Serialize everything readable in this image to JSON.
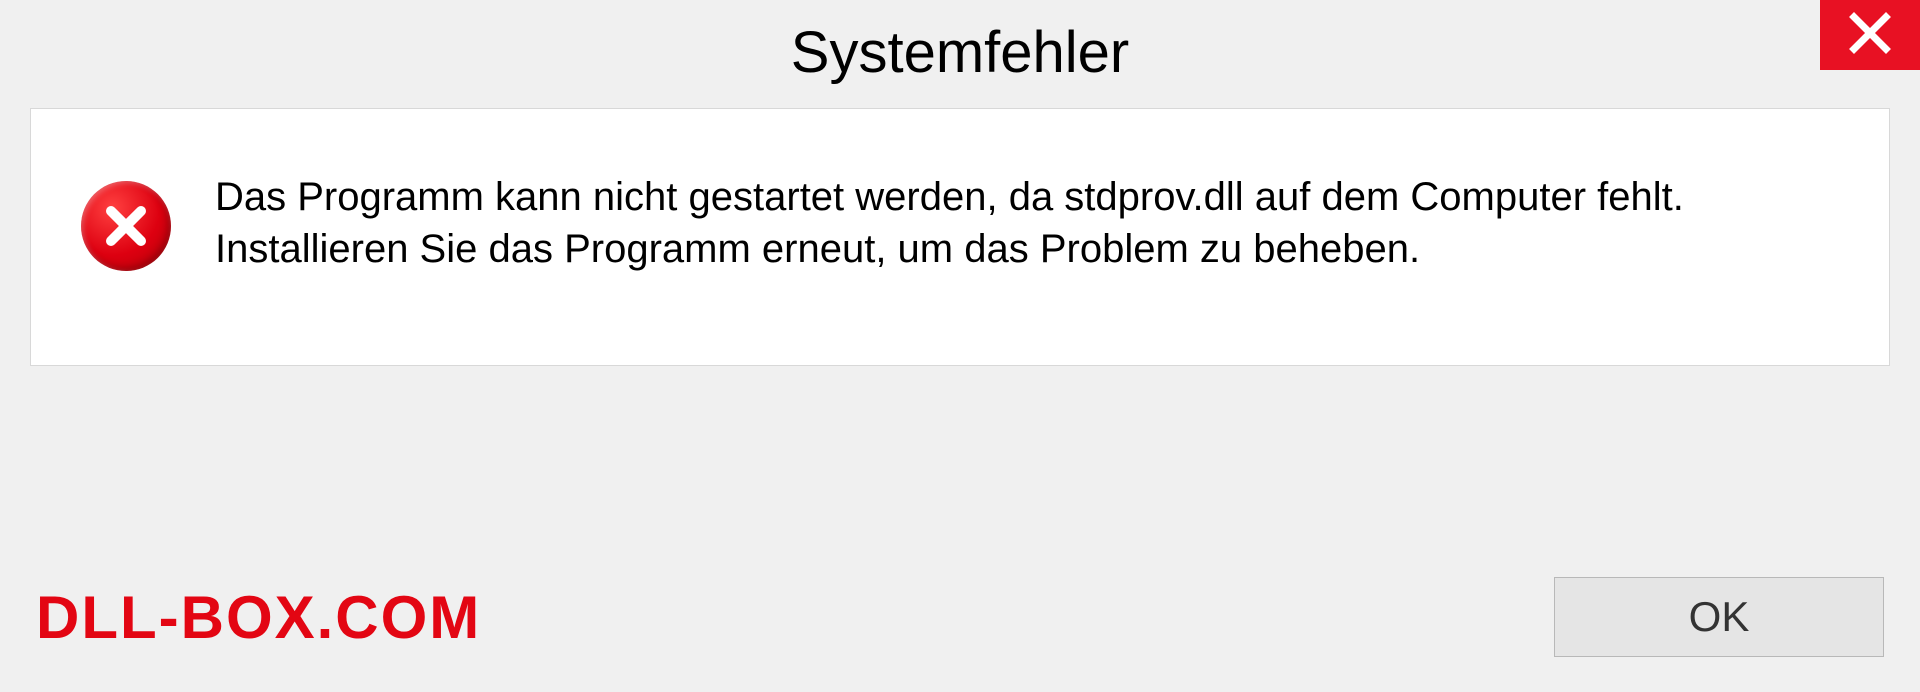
{
  "dialog": {
    "title": "Systemfehler",
    "message": "Das Programm kann nicht gestartet werden, da stdprov.dll auf dem Computer fehlt. Installieren Sie das Programm erneut, um das Problem zu beheben.",
    "ok_label": "OK"
  },
  "watermark": "DLL-BOX.COM",
  "colors": {
    "close_button": "#e81123",
    "error_icon": "#dd0010",
    "watermark": "#e30613"
  }
}
